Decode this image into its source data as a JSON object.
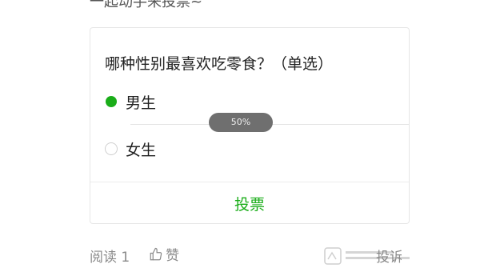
{
  "intro_text": "一起动手来投票~",
  "poll": {
    "question": "哪种性别最喜欢吃零食？（单选）",
    "options": [
      {
        "label": "男生",
        "selected": true
      },
      {
        "label": "女生",
        "selected": false
      }
    ],
    "percent_badge": "50%",
    "vote_label": "投票"
  },
  "footer": {
    "read_label": "阅读 1",
    "like_label": "赞",
    "report_label": "投诉"
  },
  "colors": {
    "accent": "#1aad19",
    "muted_text": "#8a8a8a",
    "badge_bg": "#6f6f6f"
  },
  "icons": {
    "like": "thumbs-up-icon",
    "selected_radio": "radio-checked-icon",
    "unselected_radio": "radio-unchecked-icon"
  }
}
